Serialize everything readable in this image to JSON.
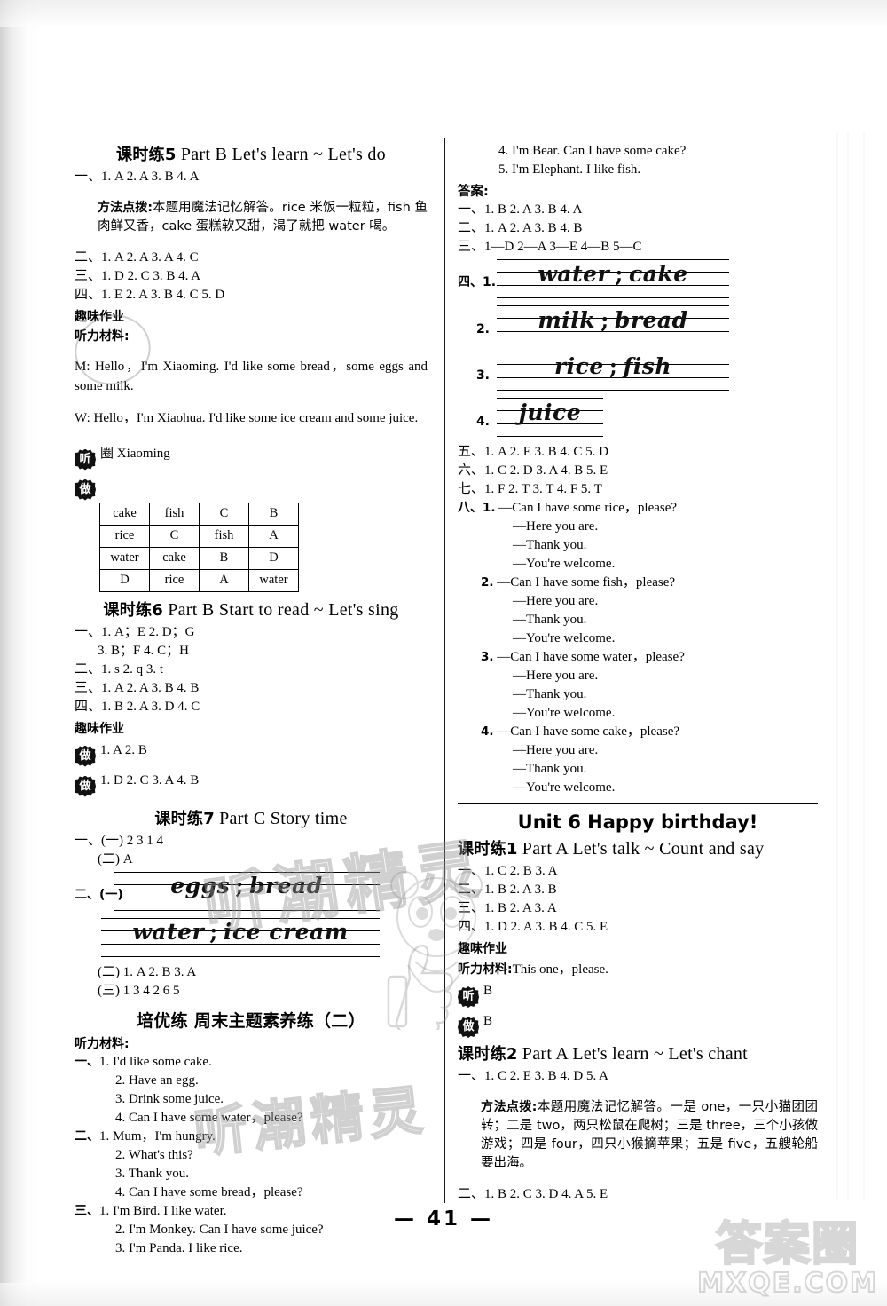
{
  "page": {
    "number": "41",
    "number_display": "— 41 —"
  },
  "watermark": {
    "cn_big": "听潮精灵",
    "cn_mid": "听潮精灵",
    "corner_cn": "答案圈",
    "corner_domain": "MXQE.COM"
  },
  "left_column": {
    "lesson5": {
      "heading_cn": "课时练5",
      "heading_en": "Part B   Let's learn ~ Let's do",
      "answers": [
        "一、1. A  2. A  3. B  4. A",
        "二、1. A  2. A  3. A  4. C",
        "三、1. D  2. C  3. B  4. A",
        "四、1. E  2. A  3. B  4. C  5. D"
      ],
      "tip_label": "方法点拨:",
      "tip_text": "本题用魔法记忆解答。rice 米饭一粒粒，fish 鱼肉鲜又香，cake 蛋糕软又甜，渴了就把 water 喝。",
      "fun_label": "趣味作业",
      "listening_label": "听力材料:",
      "script": [
        "M: Hello，I'm Xiaoming. I'd like some bread，some eggs and some milk.",
        "W: Hello，I'm Xiaohua.  I'd like some ice cream and some juice."
      ],
      "listen_badge": "听",
      "listen_answer": "圈 Xiaoming",
      "do_badge": "做",
      "grid": [
        [
          "cake",
          "fish",
          "C",
          "B"
        ],
        [
          "rice",
          "C",
          "fish",
          "A"
        ],
        [
          "water",
          "cake",
          "B",
          "D"
        ],
        [
          "D",
          "rice",
          "A",
          "water"
        ]
      ]
    },
    "lesson6": {
      "heading_cn": "课时练6",
      "heading_en": "Part B   Start to read ~ Let's sing",
      "answers": [
        "一、1. A；E  2. D；G",
        "3. B；F  4. C；H",
        "二、1. s  2. q  3. t",
        "三、1. A  2. A  3. B  4. B",
        "四、1. B  2. A  3. D  4. C"
      ],
      "fun_label": "趣味作业",
      "badge_rows": [
        {
          "badge": "做",
          "text": "1. A  2. B"
        },
        {
          "badge": "做",
          "text": "1. D  2. C  3. A  4. B"
        }
      ]
    },
    "lesson7": {
      "heading_cn": "课时练7",
      "heading_en": "Part C   Story time",
      "line1": "一、(一)  2  3  1  4",
      "line2": "(二) A",
      "write_label": "二、(一)",
      "handwriting": [
        {
          "left": "eggs",
          "sep": ";",
          "right": "bread"
        },
        {
          "left": "water",
          "sep": ";",
          "right": "ice cream"
        }
      ],
      "line3": "(二) 1. A  2. B  3. A",
      "line4": "(三) 1  3  4  2  6  5"
    },
    "peiyou": {
      "heading_cn": "培优练   周末主题素养练（二）",
      "listening_label": "听力材料:",
      "groups": [
        {
          "label": "一、",
          "items": [
            "1. I'd like some cake.",
            "2. Have an egg.",
            "3. Drink some juice.",
            "4. Can I have some water，please?"
          ]
        },
        {
          "label": "二、",
          "items": [
            "1. Mum，I'm hungry.",
            "2. What's this?",
            "3. Thank you.",
            "4. Can I have some bread，please?"
          ]
        },
        {
          "label": "三、",
          "items": [
            "1. I'm Bird.  I like water.",
            "2. I'm Monkey.  Can I have some juice?",
            "3. I'm Panda.  I like rice."
          ]
        }
      ]
    }
  },
  "right_column": {
    "script_cont": [
      "4. I'm Bear.  Can I have some cake?",
      "5. I'm Elephant.  I like fish."
    ],
    "answer_label": "答案:",
    "answers_top": [
      "一、1. B  2. A  3. B  4. A",
      "二、1. A  2. A  3. B  4. B",
      "三、1—D  2—A  3—E  4—B  5—C"
    ],
    "write_section": {
      "label": "四、",
      "rows": [
        {
          "num": "1.",
          "left": "water",
          "sep": ";",
          "right": "cake"
        },
        {
          "num": "2.",
          "left": "milk",
          "sep": ";",
          "right": "bread"
        },
        {
          "num": "3.",
          "left": "rice",
          "sep": ";",
          "right": "fish"
        },
        {
          "num": "4.",
          "left": "juice",
          "sep": "",
          "right": ""
        }
      ]
    },
    "answers_mid": [
      "五、1. A  2. E  3. B  4. C  5. D",
      "六、1. C  2. D  3. A  4. B  5. E",
      "七、1. F  2. T  3. T  4. F  5. T"
    ],
    "dialogues": {
      "label": "八、",
      "items": [
        {
          "num": "1.",
          "lines": [
            "—Can I have some rice，please?",
            "—Here you are.",
            "—Thank you.",
            "—You're welcome."
          ]
        },
        {
          "num": "2.",
          "lines": [
            "—Can I have some fish，please?",
            "—Here you are.",
            "—Thank you.",
            "—You're welcome."
          ]
        },
        {
          "num": "3.",
          "lines": [
            "—Can I have some water，please?",
            "—Here you are.",
            "—Thank you.",
            "—You're welcome."
          ]
        },
        {
          "num": "4.",
          "lines": [
            "—Can I have some cake，please?",
            "—Here you are.",
            "—Thank you.",
            "—You're welcome."
          ]
        }
      ]
    },
    "unit6": {
      "title": "Unit 6   Happy birthday!",
      "lesson1": {
        "heading_cn": "课时练1",
        "heading_en": "Part A   Let's talk ~ Count and say",
        "answers": [
          "一、1. C  2. B  3. A",
          "二、1. B  2. A  3. B",
          "三、1. B  2. A  3. A",
          "四、1. D  2. A  3. B  4. C  5. E"
        ],
        "fun_label": "趣味作业",
        "listening_label": "听力材料:",
        "listening_text": "This one，please.",
        "badge_rows": [
          {
            "badge": "听",
            "text": "B"
          },
          {
            "badge": "做",
            "text": "B"
          }
        ]
      },
      "lesson2": {
        "heading_cn": "课时练2",
        "heading_en": "Part A   Let's learn ~ Let's chant",
        "answer1": "一、1. C  2. E  3. B  4. D  5. A",
        "tip_label": "方法点拨:",
        "tip_text": "本题用魔法记忆解答。一是 one，一只小猫团团转；二是 two，两只松鼠在爬树；三是 three，三个小孩做游戏；四是 four，四只小猴摘苹果；五是 five，五艘轮船要出海。",
        "answer2": "二、1. B  2. C  3. D  4. A  5. E"
      }
    }
  }
}
